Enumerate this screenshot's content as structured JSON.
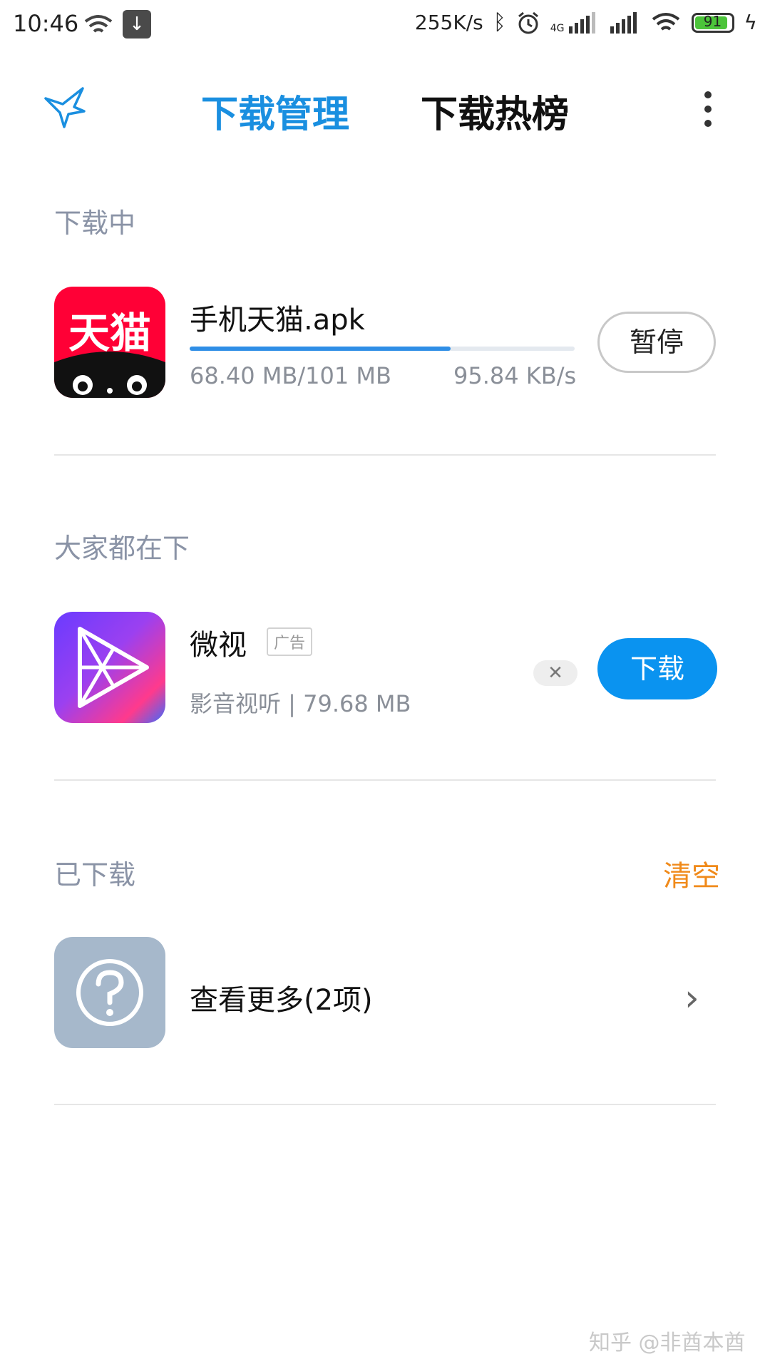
{
  "status_bar": {
    "time": "10:46",
    "speed": "255K/s",
    "network": "4G",
    "battery": "91",
    "battery_level": 0.91
  },
  "header": {
    "tab_active": "下载管理",
    "tab_inactive": "下载热榜",
    "accent_color": "#1a8fe0"
  },
  "downloading": {
    "section_title": "下载中",
    "app": {
      "icon_text": "天猫",
      "name": "手机天猫.apk",
      "progress_text": "68.40 MB/101 MB",
      "progress_fraction": 0.677,
      "speed": "95.84 KB/s",
      "action": "暂停"
    }
  },
  "recommended": {
    "section_title": "大家都在下",
    "app": {
      "name": "微视",
      "ad_label": "广告",
      "meta": "影音视听 | 79.68 MB",
      "action": "下载"
    }
  },
  "downloaded": {
    "section_title": "已下载",
    "clear_label": "清空",
    "more_label": "查看更多(2项)"
  },
  "watermark": "知乎 @非酋本酋"
}
